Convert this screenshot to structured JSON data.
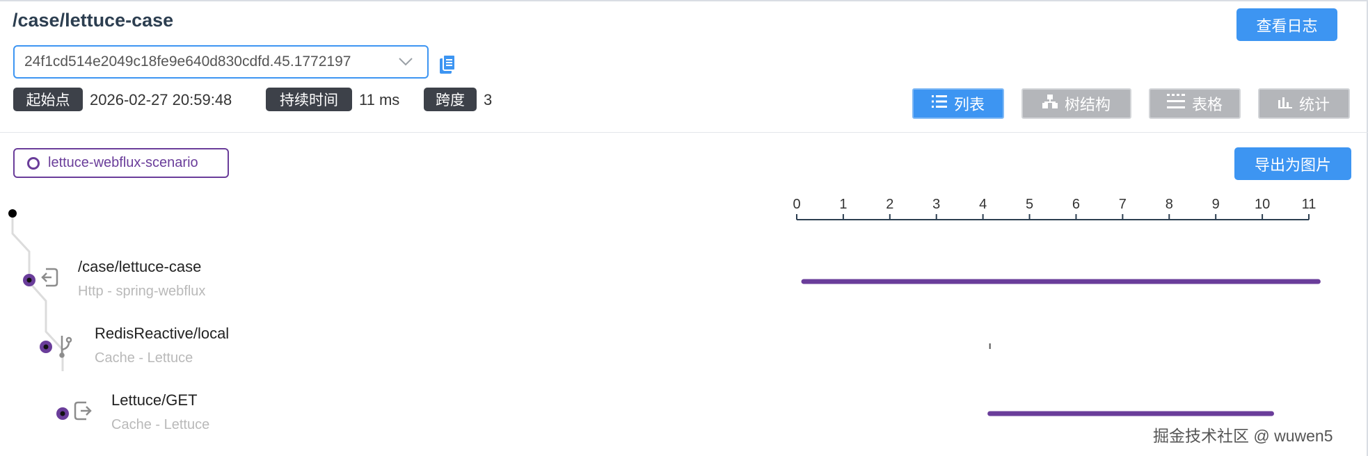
{
  "page": {
    "title": "/case/lettuce-case"
  },
  "header": {
    "view_log_label": "查看日志",
    "trace_id": "24f1cd514e2049c18fe9e640d830cdfd.45.1772197",
    "start_label": "起始点",
    "start_value": "2026-02-27 20:59:48",
    "duration_label": "持续时间",
    "duration_value": "11 ms",
    "spans_label": "跨度",
    "spans_value": "3"
  },
  "views": [
    {
      "label": "列表",
      "icon": "list-icon",
      "active": true
    },
    {
      "label": "树结构",
      "icon": "tree-icon",
      "active": false
    },
    {
      "label": "表格",
      "icon": "table-icon",
      "active": false
    },
    {
      "label": "统计",
      "icon": "stats-icon",
      "active": false
    }
  ],
  "scenario_label": "lettuce-webflux-scenario",
  "export_label": "导出为图片",
  "timeline": {
    "ticks": [
      "0",
      "1",
      "2",
      "3",
      "4",
      "5",
      "6",
      "7",
      "8",
      "9",
      "10",
      "11"
    ],
    "max": 11
  },
  "spans": [
    {
      "name": "/case/lettuce-case",
      "sub": "Http - spring-webflux",
      "start": 0.15,
      "end": 11.2,
      "icon": "entry-icon",
      "depth": 0
    },
    {
      "name": "RedisReactive/local",
      "sub": "Cache - Lettuce",
      "start": 4.15,
      "end": 4.15,
      "icon": "branch-icon",
      "depth": 1
    },
    {
      "name": "Lettuce/GET",
      "sub": "Cache - Lettuce",
      "start": 4.15,
      "end": 10.2,
      "icon": "exit-icon",
      "depth": 2
    }
  ],
  "colors": {
    "accent": "#3d95f2",
    "span": "#6a3d9a",
    "tag_bg": "#3d4149"
  },
  "watermark": "掘金技术社区 @ wuwen5"
}
